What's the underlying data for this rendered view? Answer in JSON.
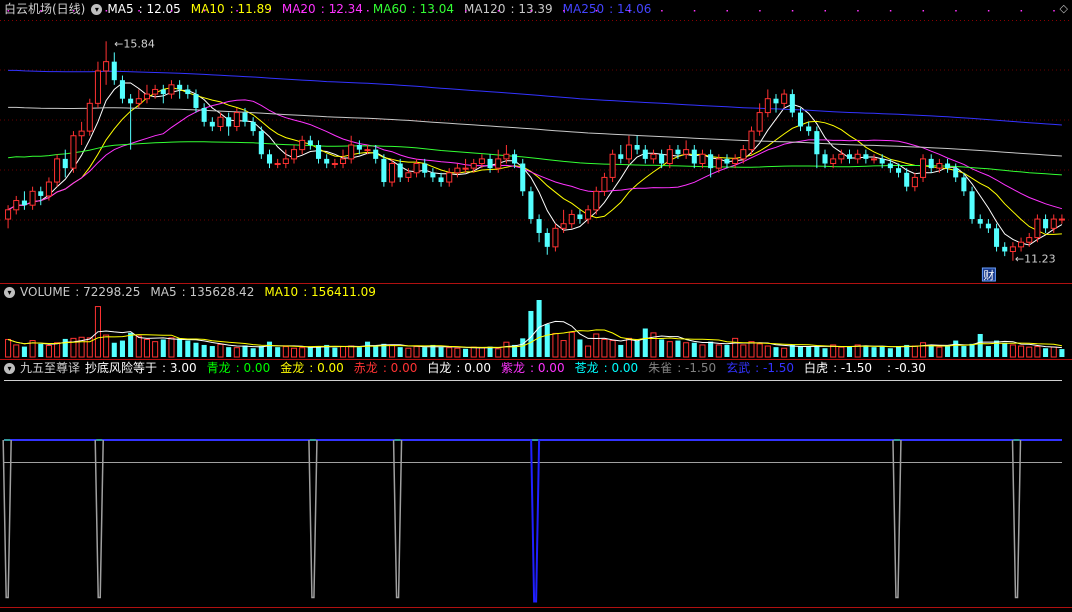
{
  "chart_data": [
    {
      "type": "candlestick",
      "panel": "price",
      "title": "白云机场(日线)",
      "legend": [
        {
          "name": "MA5",
          "value": "12.05",
          "color": "#ffffff"
        },
        {
          "name": "MA10",
          "value": "11.89",
          "color": "#ffff00"
        },
        {
          "name": "MA20",
          "value": "12.34",
          "color": "#ff33ff"
        },
        {
          "name": "MA60",
          "value": "13.04",
          "color": "#33ff33"
        },
        {
          "name": "MA120",
          "value": "13.39",
          "color": "#c8c8c8"
        },
        {
          "name": "MA250",
          "value": "14.06",
          "color": "#3333ff"
        }
      ],
      "annotations": [
        {
          "label": "15.84",
          "kind": "high"
        },
        {
          "label": "11.23",
          "kind": "low"
        },
        {
          "label": "财",
          "kind": "event"
        }
      ],
      "ylim": [
        10.9,
        16.3
      ],
      "candles": [
        [
          12.0,
          12.2,
          11.8,
          12.3
        ],
        [
          12.2,
          12.4,
          12.1,
          12.5
        ],
        [
          12.4,
          12.3,
          12.2,
          12.6
        ],
        [
          12.3,
          12.6,
          12.2,
          12.7
        ],
        [
          12.6,
          12.5,
          12.3,
          12.7
        ],
        [
          12.5,
          12.8,
          12.4,
          12.9
        ],
        [
          12.8,
          13.3,
          12.7,
          13.4
        ],
        [
          13.3,
          13.1,
          12.9,
          13.5
        ],
        [
          13.1,
          13.8,
          13.0,
          13.9
        ],
        [
          13.8,
          13.9,
          13.6,
          14.1
        ],
        [
          13.9,
          14.5,
          13.8,
          14.6
        ],
        [
          14.5,
          15.2,
          14.4,
          15.4
        ],
        [
          15.2,
          15.4,
          14.9,
          15.84
        ],
        [
          15.4,
          15.0,
          14.9,
          15.6
        ],
        [
          15.0,
          14.6,
          14.5,
          15.1
        ],
        [
          14.6,
          14.5,
          13.5,
          14.7
        ],
        [
          14.5,
          14.6,
          14.4,
          14.8
        ],
        [
          14.6,
          14.7,
          14.5,
          14.9
        ],
        [
          14.7,
          14.8,
          14.6,
          14.9
        ],
        [
          14.8,
          14.7,
          14.5,
          14.9
        ],
        [
          14.7,
          14.9,
          14.6,
          15.0
        ],
        [
          14.9,
          14.8,
          14.6,
          15.0
        ],
        [
          14.8,
          14.7,
          14.6,
          14.9
        ],
        [
          14.7,
          14.4,
          14.3,
          14.8
        ],
        [
          14.4,
          14.1,
          14.0,
          14.5
        ],
        [
          14.1,
          14.0,
          13.9,
          14.2
        ],
        [
          14.0,
          14.2,
          13.9,
          14.3
        ],
        [
          14.2,
          14.0,
          13.8,
          14.3
        ],
        [
          14.0,
          14.3,
          13.9,
          14.4
        ],
        [
          14.3,
          14.1,
          14.0,
          14.4
        ],
        [
          14.1,
          13.9,
          13.8,
          14.2
        ],
        [
          13.9,
          13.4,
          13.3,
          14.0
        ],
        [
          13.4,
          13.2,
          13.1,
          13.5
        ],
        [
          13.2,
          13.2,
          13.1,
          13.3
        ],
        [
          13.2,
          13.3,
          13.1,
          13.5
        ],
        [
          13.3,
          13.5,
          13.2,
          13.6
        ],
        [
          13.5,
          13.7,
          13.4,
          13.8
        ],
        [
          13.7,
          13.6,
          13.5,
          13.8
        ],
        [
          13.6,
          13.3,
          13.2,
          13.7
        ],
        [
          13.3,
          13.2,
          13.1,
          13.4
        ],
        [
          13.2,
          13.2,
          13.1,
          13.3
        ],
        [
          13.2,
          13.3,
          13.1,
          13.5
        ],
        [
          13.3,
          13.6,
          13.2,
          13.8
        ],
        [
          13.6,
          13.5,
          13.4,
          13.7
        ],
        [
          13.5,
          13.5,
          13.4,
          13.6
        ],
        [
          13.5,
          13.3,
          13.2,
          13.6
        ],
        [
          13.3,
          12.8,
          12.7,
          13.4
        ],
        [
          12.8,
          13.2,
          12.7,
          13.3
        ],
        [
          13.2,
          12.9,
          12.8,
          13.3
        ],
        [
          12.9,
          13.0,
          12.8,
          13.1
        ],
        [
          13.0,
          13.2,
          12.9,
          13.3
        ],
        [
          13.2,
          13.0,
          12.9,
          13.3
        ],
        [
          13.0,
          12.9,
          12.8,
          13.1
        ],
        [
          12.9,
          12.8,
          12.7,
          13.0
        ],
        [
          12.8,
          13.0,
          12.7,
          13.1
        ],
        [
          13.0,
          13.1,
          12.9,
          13.2
        ],
        [
          13.1,
          13.1,
          13.0,
          13.3
        ],
        [
          13.1,
          13.2,
          13.0,
          13.3
        ],
        [
          13.2,
          13.3,
          13.1,
          13.4
        ],
        [
          13.3,
          13.1,
          13.0,
          13.4
        ],
        [
          13.1,
          13.3,
          13.0,
          13.5
        ],
        [
          13.3,
          13.4,
          13.2,
          13.6
        ],
        [
          13.4,
          13.2,
          13.1,
          13.5
        ],
        [
          13.2,
          12.6,
          12.5,
          13.3
        ],
        [
          12.6,
          12.0,
          11.9,
          12.7
        ],
        [
          12.0,
          11.7,
          11.5,
          12.1
        ],
        [
          11.7,
          11.4,
          11.23,
          11.8
        ],
        [
          11.4,
          11.8,
          11.3,
          11.9
        ],
        [
          11.8,
          11.9,
          11.7,
          12.2
        ],
        [
          11.9,
          12.1,
          11.8,
          12.2
        ],
        [
          12.1,
          12.0,
          11.9,
          12.2
        ],
        [
          12.0,
          12.2,
          11.9,
          12.3
        ],
        [
          12.2,
          12.6,
          12.1,
          12.7
        ],
        [
          12.6,
          12.9,
          12.5,
          13.0
        ],
        [
          12.9,
          13.4,
          12.8,
          13.5
        ],
        [
          13.4,
          13.3,
          13.2,
          13.6
        ],
        [
          13.3,
          13.6,
          13.2,
          13.8
        ],
        [
          13.6,
          13.5,
          13.4,
          13.8
        ],
        [
          13.5,
          13.3,
          13.2,
          13.6
        ],
        [
          13.3,
          13.4,
          13.2,
          13.5
        ],
        [
          13.4,
          13.2,
          13.1,
          13.5
        ],
        [
          13.2,
          13.5,
          13.1,
          13.6
        ],
        [
          13.5,
          13.4,
          13.3,
          13.6
        ],
        [
          13.4,
          13.5,
          13.3,
          13.7
        ],
        [
          13.5,
          13.2,
          13.1,
          13.6
        ],
        [
          13.2,
          13.4,
          13.1,
          13.5
        ],
        [
          13.4,
          13.1,
          12.9,
          13.5
        ],
        [
          13.1,
          13.3,
          13.0,
          13.4
        ],
        [
          13.3,
          13.2,
          13.1,
          13.4
        ],
        [
          13.2,
          13.3,
          13.1,
          13.4
        ],
        [
          13.3,
          13.5,
          13.2,
          13.6
        ],
        [
          13.5,
          13.9,
          13.4,
          14.0
        ],
        [
          13.9,
          14.3,
          13.8,
          14.5
        ],
        [
          14.3,
          14.6,
          14.2,
          14.8
        ],
        [
          14.6,
          14.5,
          14.3,
          14.7
        ],
        [
          14.5,
          14.7,
          14.4,
          14.8
        ],
        [
          14.7,
          14.3,
          14.2,
          14.8
        ],
        [
          14.3,
          14.0,
          13.9,
          14.4
        ],
        [
          14.0,
          13.9,
          13.8,
          14.1
        ],
        [
          13.9,
          13.4,
          13.1,
          14.0
        ],
        [
          13.4,
          13.2,
          13.1,
          13.5
        ],
        [
          13.2,
          13.3,
          13.1,
          13.4
        ],
        [
          13.3,
          13.4,
          13.2,
          13.5
        ],
        [
          13.4,
          13.3,
          13.2,
          13.5
        ],
        [
          13.3,
          13.4,
          13.2,
          13.5
        ],
        [
          13.4,
          13.3,
          13.2,
          13.5
        ],
        [
          13.3,
          13.3,
          13.2,
          13.4
        ],
        [
          13.3,
          13.2,
          13.1,
          13.4
        ],
        [
          13.2,
          13.1,
          13.0,
          13.3
        ],
        [
          13.1,
          13.0,
          12.9,
          13.2
        ],
        [
          13.0,
          12.7,
          12.6,
          13.1
        ],
        [
          12.7,
          12.9,
          12.6,
          13.0
        ],
        [
          12.9,
          13.3,
          12.8,
          13.4
        ],
        [
          13.3,
          13.1,
          13.0,
          13.4
        ],
        [
          13.1,
          13.2,
          13.0,
          13.3
        ],
        [
          13.2,
          13.1,
          13.0,
          13.3
        ],
        [
          13.1,
          12.9,
          12.8,
          13.2
        ],
        [
          12.9,
          12.6,
          12.5,
          13.0
        ],
        [
          12.6,
          12.0,
          11.9,
          12.7
        ],
        [
          12.0,
          11.9,
          11.8,
          12.1
        ],
        [
          11.9,
          11.8,
          11.7,
          12.0
        ],
        [
          11.8,
          11.4,
          11.3,
          11.9
        ],
        [
          11.4,
          11.3,
          11.2,
          11.5
        ],
        [
          11.3,
          11.4,
          11.1,
          11.5
        ],
        [
          11.4,
          11.5,
          11.3,
          11.6
        ],
        [
          11.5,
          11.6,
          11.4,
          11.7
        ],
        [
          11.6,
          12.0,
          11.5,
          12.1
        ],
        [
          12.0,
          11.8,
          11.7,
          12.1
        ],
        [
          11.8,
          12.0,
          11.7,
          12.1
        ],
        [
          12.0,
          12.0,
          11.9,
          12.1
        ]
      ]
    },
    {
      "type": "bar",
      "panel": "volume",
      "legend": [
        {
          "name": "VOLUME",
          "value": "72298.25",
          "color": "#c8c8c8"
        },
        {
          "name": "MA5",
          "value": "135628.42",
          "color": "#c8c8c8"
        },
        {
          "name": "MA10",
          "value": "156411.09",
          "color": "#ffff00"
        }
      ],
      "ylim": [
        0,
        520000
      ],
      "values": [
        160000,
        110000,
        95000,
        150000,
        120000,
        105000,
        130000,
        165000,
        170000,
        180000,
        175000,
        460000,
        200000,
        130000,
        150000,
        220000,
        190000,
        160000,
        140000,
        160000,
        175000,
        170000,
        150000,
        130000,
        110000,
        100000,
        115000,
        90000,
        85000,
        105000,
        80000,
        100000,
        140000,
        90000,
        95000,
        80000,
        85000,
        90000,
        100000,
        110000,
        85000,
        95000,
        100000,
        90000,
        140000,
        100000,
        120000,
        110000,
        90000,
        80000,
        95000,
        90000,
        110000,
        90000,
        85000,
        80000,
        75000,
        90000,
        85000,
        95000,
        75000,
        135000,
        110000,
        170000,
        420000,
        520000,
        300000,
        215000,
        150000,
        225000,
        160000,
        100000,
        210000,
        160000,
        150000,
        110000,
        170000,
        150000,
        260000,
        220000,
        160000,
        140000,
        150000,
        130000,
        130000,
        110000,
        140000,
        110000,
        110000,
        170000,
        110000,
        140000,
        120000,
        100000,
        90000,
        80000,
        110000,
        100000,
        100000,
        95000,
        80000,
        110000,
        90000,
        100000,
        110000,
        100000,
        90000,
        95000,
        80000,
        100000,
        110000,
        100000,
        130000,
        110000,
        90000,
        100000,
        150000,
        100000,
        120000,
        210000,
        100000,
        150000,
        130000,
        110000,
        100000,
        90000,
        95000,
        80000,
        90000,
        72298
      ],
      "up": [
        true,
        true,
        false,
        true,
        false,
        true,
        true,
        false,
        true,
        true,
        true,
        true,
        true,
        false,
        false,
        false,
        true,
        true,
        true,
        false,
        true,
        false,
        false,
        false,
        false,
        false,
        true,
        false,
        true,
        false,
        false,
        false,
        false,
        false,
        true,
        true,
        true,
        false,
        false,
        false,
        false,
        true,
        true,
        false,
        false,
        false,
        false,
        true,
        false,
        true,
        true,
        false,
        false,
        false,
        true,
        true,
        false,
        true,
        true,
        false,
        true,
        true,
        false,
        false,
        false,
        false,
        false,
        true,
        true,
        true,
        false,
        true,
        true,
        true,
        true,
        false,
        true,
        false,
        false,
        true,
        false,
        true,
        false,
        true,
        false,
        true,
        false,
        true,
        false,
        true,
        true,
        true,
        true,
        true,
        false,
        true,
        false,
        false,
        false,
        false,
        false,
        true,
        true,
        false,
        true,
        false,
        false,
        false,
        false,
        false,
        false,
        true,
        true,
        false,
        true,
        false,
        false,
        false,
        false,
        false,
        false,
        false,
        false,
        true,
        true,
        true,
        true,
        false,
        true,
        false
      ]
    },
    {
      "type": "line",
      "panel": "indicator",
      "title": "九五至尊译",
      "legend": [
        {
          "name": "抄底风险等于",
          "value": "3.00",
          "color": "#ffffff"
        },
        {
          "name": "青龙",
          "value": "0.00",
          "color": "#00ff00"
        },
        {
          "name": "金龙",
          "value": "0.00",
          "color": "#ffff00"
        },
        {
          "name": "赤龙",
          "value": "0.00",
          "color": "#ff3333"
        },
        {
          "name": "白龙",
          "value": "0.00",
          "color": "#ffffff"
        },
        {
          "name": "紫龙",
          "value": "0.00",
          "color": "#ff33ff"
        },
        {
          "name": "苍龙",
          "value": "0.00",
          "color": "#00ffff"
        },
        {
          "name": "朱雀",
          "value": "-1.50",
          "color": "#808080"
        },
        {
          "name": "玄武",
          "value": "-1.50",
          "color": "#3333ff"
        },
        {
          "name": "白虎",
          "value": "-1.50",
          "color": "#ffffff"
        },
        {
          "name": "",
          "value": "-0.30",
          "color": "#ffffff"
        }
      ],
      "ylim": [
        -2.2,
        0.8
      ],
      "baseline": 0,
      "reference": -0.3,
      "grey_dips": [
        0.3,
        9.0,
        29.2,
        37.2,
        84.4,
        95.7
      ],
      "blue_dips": [
        50.2
      ]
    }
  ]
}
